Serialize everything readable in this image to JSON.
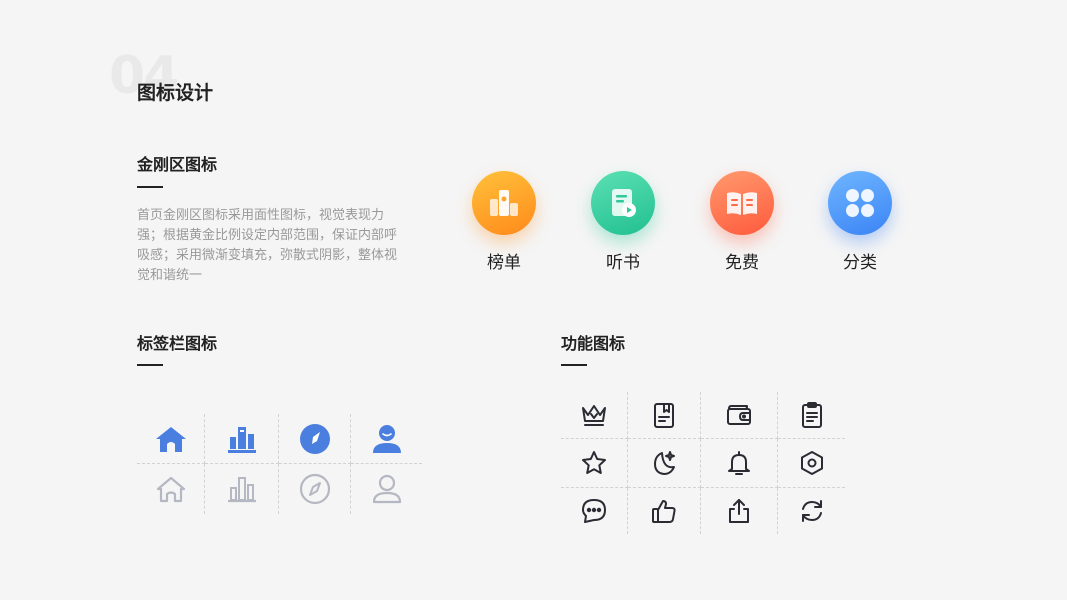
{
  "section_number": "04",
  "page_title": "图标设计",
  "kingkong": {
    "title": "金刚区图标",
    "description": "首页金刚区图标采用面性图标，视觉表现力强；根据黄金比例设定内部范围，保证内部呼吸感；采用微渐变填充，弥散式阴影，整体视觉和谐统一",
    "items": [
      {
        "label": "榜单",
        "icon": "ranking-icon",
        "color": "#ff9f24"
      },
      {
        "label": "听书",
        "icon": "audiobook-icon",
        "color": "#2fc99a"
      },
      {
        "label": "免费",
        "icon": "open-book-icon",
        "color": "#ff6a48"
      },
      {
        "label": "分类",
        "icon": "category-icon",
        "color": "#4a90f7"
      }
    ]
  },
  "tabbar": {
    "title": "标签栏图标",
    "active_color": "#4a7fe0",
    "inactive_color": "#b5b8c2",
    "icons": [
      "home-icon",
      "chart-icon",
      "compass-icon",
      "user-icon"
    ]
  },
  "functional": {
    "title": "功能图标",
    "icons": [
      "crown-icon",
      "bookmark-book-icon",
      "wallet-icon",
      "clipboard-icon",
      "star-icon",
      "moon-star-icon",
      "bell-icon",
      "hexagon-settings-icon",
      "chat-icon",
      "thumbs-up-icon",
      "share-icon",
      "refresh-icon"
    ]
  }
}
